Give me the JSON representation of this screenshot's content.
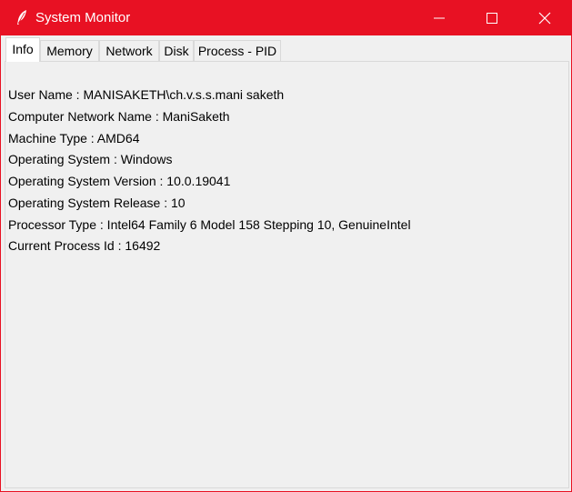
{
  "window": {
    "title": "System Monitor",
    "accent_color": "#e81123",
    "icon": "feather-icon",
    "controls": {
      "minimize_icon": "minimize-icon",
      "maximize_icon": "maximize-icon",
      "close_icon": "close-icon"
    }
  },
  "tabs": [
    {
      "label": "Info",
      "active": true
    },
    {
      "label": "Memory",
      "active": false
    },
    {
      "label": "Network",
      "active": false
    },
    {
      "label": "Disk",
      "active": false
    },
    {
      "label": "Process - PID",
      "active": false
    }
  ],
  "info": {
    "lines": [
      "User Name : MANISAKETH\\ch.v.s.s.mani saketh",
      "Computer Network Name : ManiSaketh",
      "Machine Type : AMD64",
      "Operating System : Windows",
      "Operating System Version : 10.0.19041",
      "Operating System Release : 10",
      "Processor Type : Intel64 Family 6 Model 158 Stepping 10, GenuineIntel",
      "Current Process Id : 16492"
    ]
  }
}
